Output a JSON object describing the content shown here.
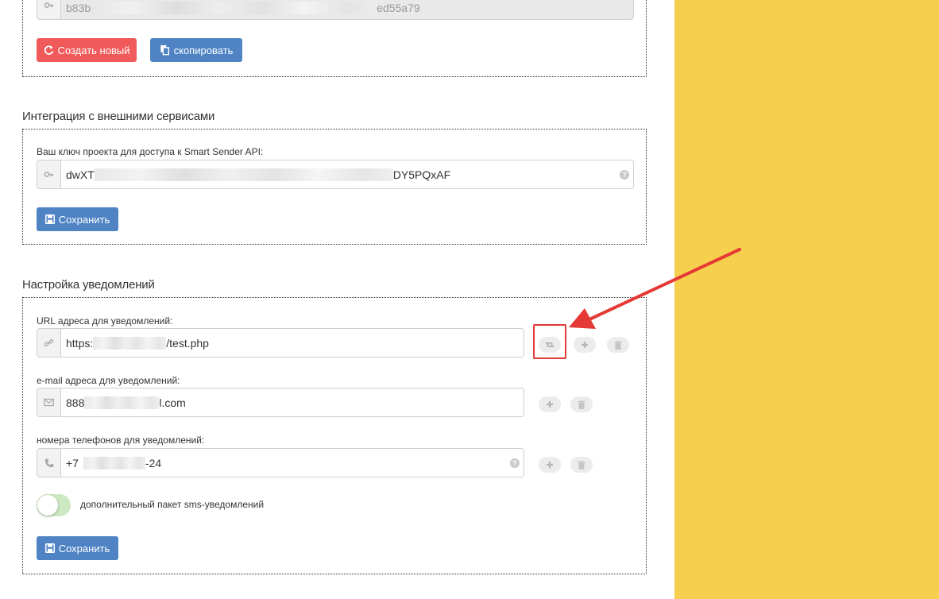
{
  "token_section": {
    "value_start": "b83b",
    "value_end": "ed55a79",
    "create_new_label": "Создать новый",
    "copy_label": "скопировать"
  },
  "integration": {
    "title": "Интеграция с внешними сервисами",
    "api_key_label": "Ваш ключ проекта для доступа к Smart Sender API:",
    "api_key_start": "dwXT",
    "api_key_end": "DY5PQxAF",
    "save_label": "Сохранить"
  },
  "notifications": {
    "title": "Настройка уведомлений",
    "url_label": "URL адреса для уведомлений:",
    "url_start": "https:",
    "url_end": "/test.php",
    "email_label": "e-mail адреса для уведомлений:",
    "email_start": "888",
    "email_end": "l.com",
    "phone_label": "номера телефонов для уведомлений:",
    "phone_start": "+7",
    "phone_end": "-24",
    "sms_toggle_label": "дополнительный пакет sms-уведомлений",
    "sms_toggle_on": false,
    "save_label": "Сохранить"
  },
  "colors": {
    "accent_yellow": "#f7cf4f",
    "button_red": "#f05a5a",
    "button_blue": "#4f83c4",
    "annotation_red": "#e53935"
  }
}
